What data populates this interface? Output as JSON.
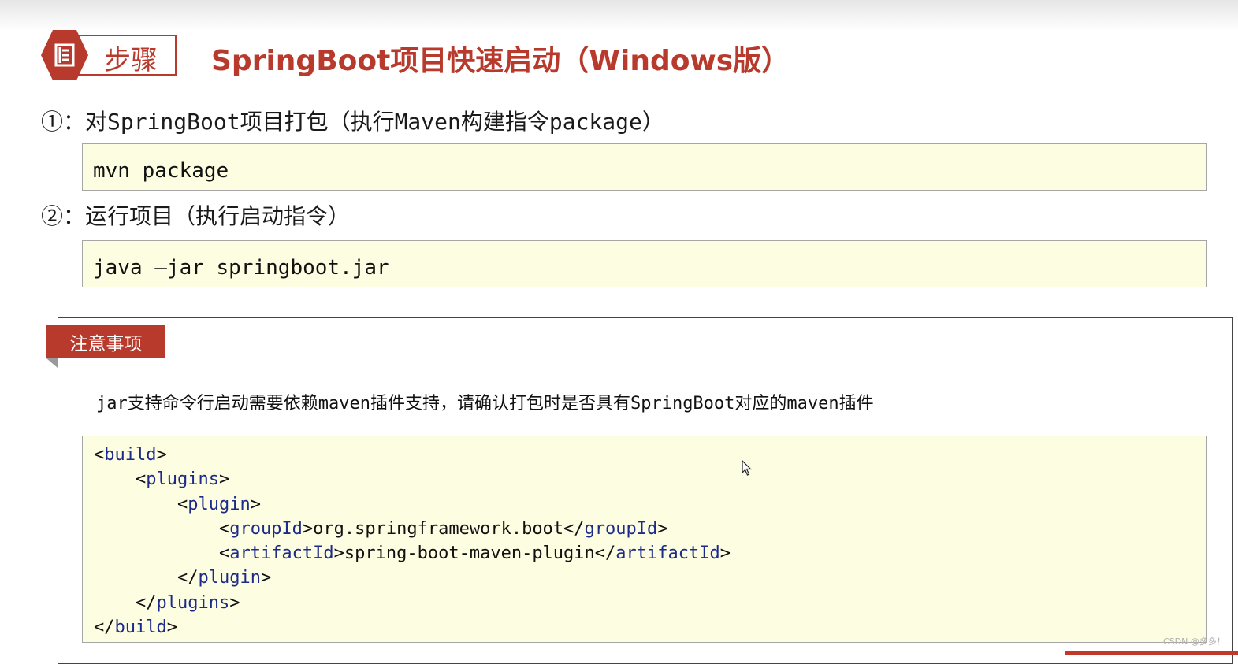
{
  "header": {
    "badge_label": "步骤",
    "title": "SpringBoot项目快速启动（Windows版）"
  },
  "steps": [
    {
      "label": "①：对SpringBoot项目打包（执行Maven构建指令package）",
      "command": "mvn package"
    },
    {
      "label": "②：运行项目（执行启动指令）",
      "command": "java –jar springboot.jar"
    }
  ],
  "notes": {
    "tab_label": "注意事项",
    "text": "jar支持命令行启动需要依赖maven插件支持，请确认打包时是否具有SpringBoot对应的maven插件",
    "code_lines": [
      {
        "indent": "",
        "parts": [
          {
            "t": "<"
          },
          {
            "t": "build",
            "c": "tag"
          },
          {
            "t": ">"
          }
        ]
      },
      {
        "indent": "    ",
        "parts": [
          {
            "t": "<"
          },
          {
            "t": "plugins",
            "c": "tag"
          },
          {
            "t": ">"
          }
        ]
      },
      {
        "indent": "        ",
        "parts": [
          {
            "t": "<"
          },
          {
            "t": "plugin",
            "c": "tag"
          },
          {
            "t": ">"
          }
        ]
      },
      {
        "indent": "            ",
        "parts": [
          {
            "t": "<"
          },
          {
            "t": "groupId",
            "c": "tag"
          },
          {
            "t": ">org.springframework.boot</"
          },
          {
            "t": "groupId",
            "c": "tag"
          },
          {
            "t": ">"
          }
        ]
      },
      {
        "indent": "            ",
        "parts": [
          {
            "t": "<"
          },
          {
            "t": "artifactId",
            "c": "tag"
          },
          {
            "t": ">spring-boot-maven-plugin</"
          },
          {
            "t": "artifactId",
            "c": "tag"
          },
          {
            "t": ">"
          }
        ]
      },
      {
        "indent": "        ",
        "parts": [
          {
            "t": "</"
          },
          {
            "t": "plugin",
            "c": "tag"
          },
          {
            "t": ">"
          }
        ]
      },
      {
        "indent": "    ",
        "parts": [
          {
            "t": "</"
          },
          {
            "t": "plugins",
            "c": "tag"
          },
          {
            "t": ">"
          }
        ]
      },
      {
        "indent": "",
        "parts": [
          {
            "t": "</"
          },
          {
            "t": "build",
            "c": "tag"
          },
          {
            "t": ">"
          }
        ]
      }
    ]
  },
  "watermark": "CSDN @多多！",
  "colors": {
    "accent": "#b83a2c",
    "code_bg": "#fdfde1",
    "xml_tag": "#1c2a8a"
  },
  "icons": {
    "badge": "document-list-icon",
    "cursor": "mouse-pointer-icon"
  }
}
